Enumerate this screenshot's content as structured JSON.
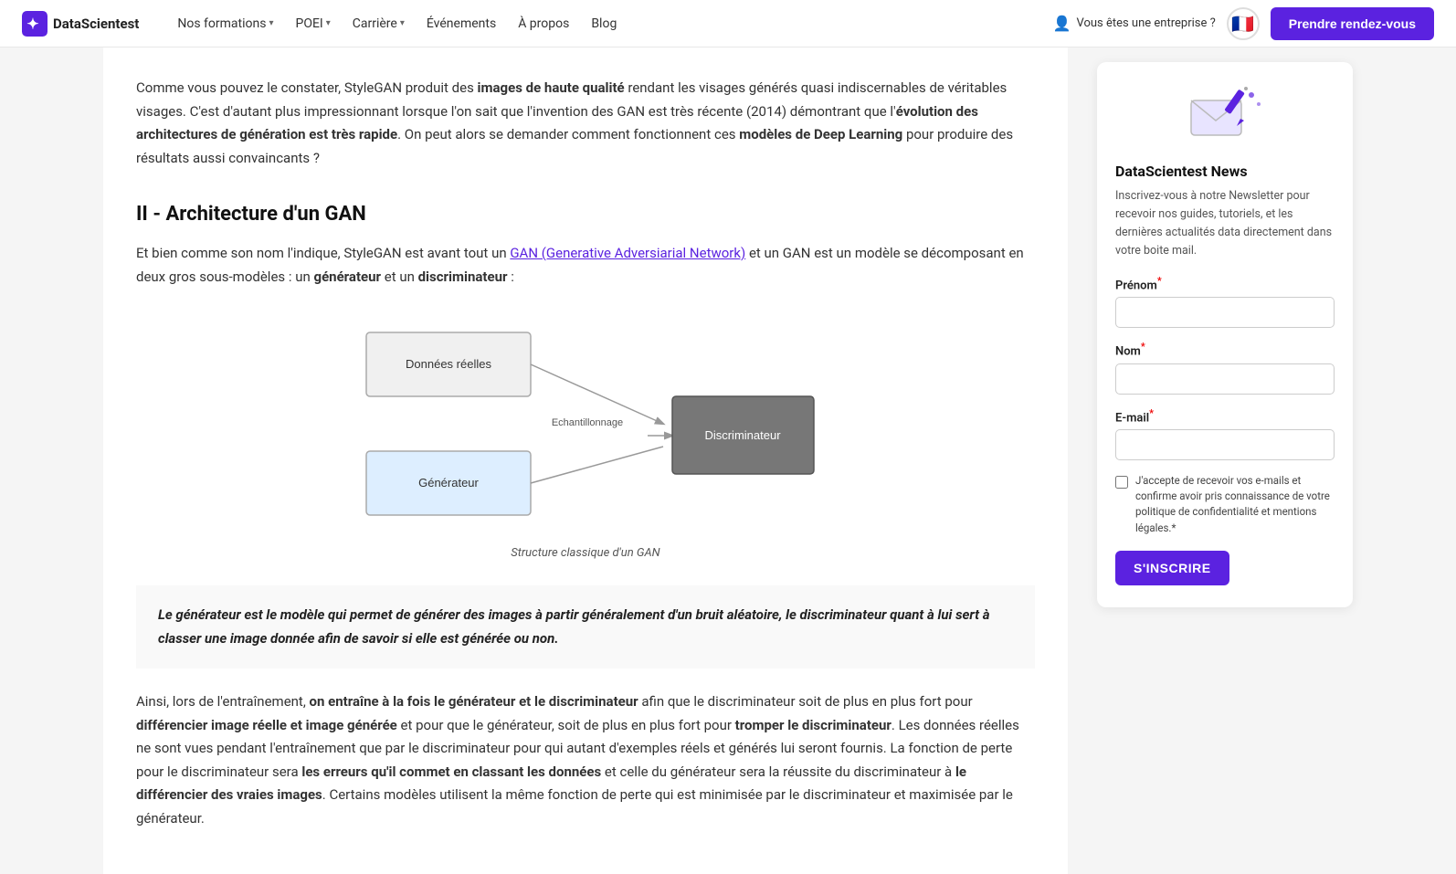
{
  "nav": {
    "logo_text": "DataScientest",
    "links": [
      {
        "label": "Nos formations",
        "has_dropdown": true
      },
      {
        "label": "POEI",
        "has_dropdown": true
      },
      {
        "label": "Carrière",
        "has_dropdown": true
      },
      {
        "label": "Événements",
        "has_dropdown": false
      },
      {
        "label": "À propos",
        "has_dropdown": false
      },
      {
        "label": "Blog",
        "has_dropdown": false
      }
    ],
    "enterprise_label": "Vous êtes une entreprise ?",
    "flag": "🇫🇷",
    "cta_label": "Prendre rendez-vous"
  },
  "content": {
    "intro_para": "Comme vous pouvez le constater, StyleGAN produit des images de haute qualité rendant les visages générés quasi indiscernables de véritables visages. C'est d'autant plus impressionnant lorsque l'on sait que l'invention des GAN est très récente (2014) démontrant que l'évolution des architectures de génération est très rapide. On peut alors se demander comment fonctionnent ces modèles de Deep Learning pour produire des résultats aussi convaincants ?",
    "section_title": "II - Architecture d'un GAN",
    "section_intro_before": "Et bien comme son nom l'indique, StyleGAN est avant tout un ",
    "section_intro_link": "GAN (Generative Adversiarial Network)",
    "section_intro_after": " et un GAN est un modèle se décomposant en deux gros sous-modèles : un générateur et un discriminateur :",
    "diagram_caption": "Structure classique d'un GAN",
    "diagram_labels": {
      "donnees_reelles": "Données réelles",
      "generateur": "Générateur",
      "echantillonnage": "Echantillonnage",
      "discriminateur": "Discriminateur"
    },
    "blockquote": "Le générateur est le modèle qui permet de générer des images à partir généralement d'un bruit aléatoire, le discriminateur quant à lui sert à classer une image donnée afin de savoir si elle est générée ou non.",
    "body_para": "Ainsi, lors de l'entraînement, on entraîne à la fois le générateur et le discriminateur afin que le discriminateur soit de plus en plus fort pour différencier image réelle et image générée et pour que le générateur, soit de plus en plus fort pour tromper le discriminateur. Les données réelles ne sont vues pendant l'entraînement que par le discriminateur pour qui autant d'exemples réels et générés lui seront fournis. La fonction de perte pour le discriminateur sera les erreurs qu'il commet en classant les données et celle du générateur sera la réussite du discriminateur à le différencier des vraies images. Certains modèles utilisent la même fonction de perte qui est minimisée par le discriminateur et maximisée par le générateur."
  },
  "sidebar": {
    "newsletter_title": "DataScientest News",
    "newsletter_desc": "Inscrivez-vous à notre Newsletter pour recevoir nos guides, tutoriels, et les dernières actualités data directement dans votre boite mail.",
    "prenom_label": "Prénom",
    "nom_label": "Nom",
    "email_label": "E-mail",
    "checkbox_text": "J'accepte de recevoir vos e-mails et confirme avoir pris connaissance de votre politique de confidentialité et mentions légales.",
    "subscribe_label": "S'INSCRIRE"
  }
}
